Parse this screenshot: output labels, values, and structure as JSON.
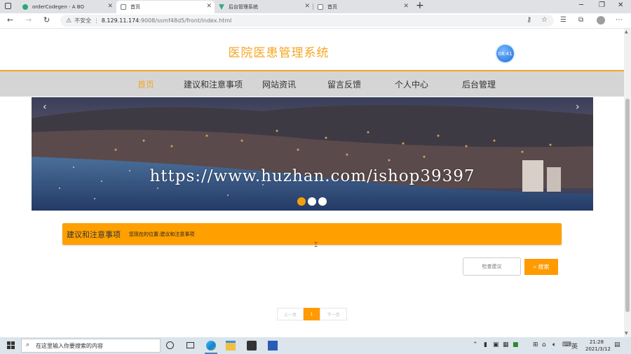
{
  "browser": {
    "tabs": [
      {
        "label": "orderCodegen - A BO",
        "favicon_color": "#2aa876"
      },
      {
        "label": "首页",
        "favicon_color": "#777777"
      },
      {
        "label": "后台管理系统",
        "favicon_color": "#3aa88a"
      },
      {
        "label": "首页",
        "favicon_color": "#777777"
      }
    ],
    "new_tab": "+",
    "address": {
      "warning": "不安全",
      "host": "8.129.11.174",
      "path": ":9008/ssmf48d5/front/index.html"
    }
  },
  "site": {
    "title": "医院医患管理系统",
    "clock": "08:41",
    "nav": [
      "首页",
      "建议和注意事项",
      "网站资讯",
      "留言反馈",
      "个人中心",
      "后台管理"
    ]
  },
  "banner": {
    "watermark": "https://www.huzhan.com/ishop39397",
    "prev": "‹",
    "next": "›",
    "dots": 3,
    "active_dot": 0
  },
  "section": {
    "title": "建议和注意事项",
    "crumb_prefix": "您现在的位置:",
    "crumb_current": "建议和注意事项"
  },
  "search": {
    "placeholder": "检查建议",
    "button_label": "搜索"
  },
  "pagination": {
    "prev": "上一页",
    "current": "1",
    "next": "下一页"
  },
  "taskbar": {
    "search_placeholder": "在这里输入你要搜索的内容",
    "ime": "英",
    "time": "21:28",
    "date": "2021/3/12"
  },
  "colors": {
    "accent": "#f5a623",
    "section_bar": "#ffa000",
    "nav_bg": "#d5d5d5"
  }
}
